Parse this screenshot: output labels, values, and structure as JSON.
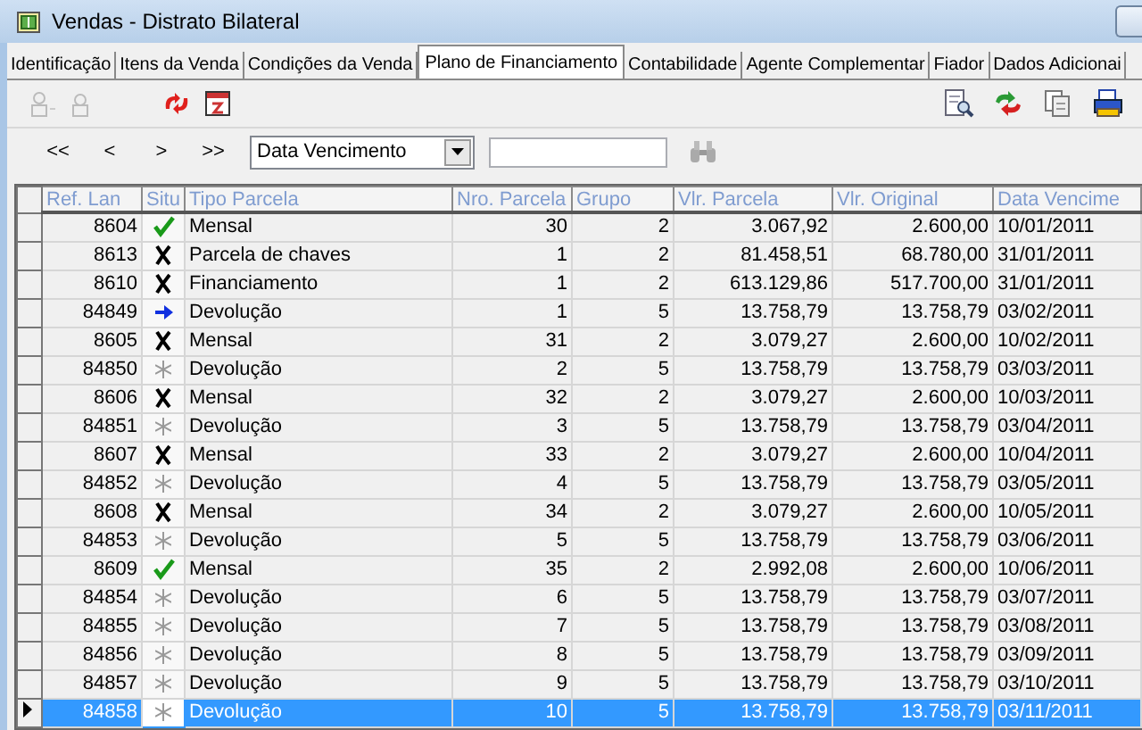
{
  "window": {
    "title": "Vendas - Distrato Bilateral"
  },
  "tabs": [
    {
      "label": "Identificação",
      "selected": false
    },
    {
      "label": "Itens da Venda",
      "selected": false
    },
    {
      "label": "Condições da Venda",
      "selected": false
    },
    {
      "label": "Plano de Financiamento",
      "selected": true
    },
    {
      "label": "Contabilidade",
      "selected": false
    },
    {
      "label": "Agente Complementar",
      "selected": false
    },
    {
      "label": "Fiador",
      "selected": false
    },
    {
      "label": "Dados Adicionai",
      "selected": false
    }
  ],
  "navigation": {
    "buttons": [
      "<<",
      "<",
      ">",
      ">>"
    ],
    "sort_field": {
      "value": "Data Vencimento"
    }
  },
  "table": {
    "columns": [
      "Ref. Lan",
      "Situ",
      "Tipo Parcela",
      "Nro. Parcela",
      "Grupo",
      "Vlr. Parcela",
      "Vlr. Original",
      "Data Vencime"
    ],
    "rows": [
      {
        "ref": "8604",
        "kind": "check",
        "tipo": "Mensal",
        "nro": "30",
        "grupo": "2",
        "vlr_parcela": "3.067,92",
        "vlr_original": "2.600,00",
        "data": "10/01/2011",
        "selected": false
      },
      {
        "ref": "8613",
        "kind": "cross",
        "tipo": "Parcela de chaves",
        "nro": "1",
        "grupo": "2",
        "vlr_parcela": "81.458,51",
        "vlr_original": "68.780,00",
        "data": "31/01/2011",
        "selected": false
      },
      {
        "ref": "8610",
        "kind": "cross",
        "tipo": "Financiamento",
        "nro": "1",
        "grupo": "2",
        "vlr_parcela": "613.129,86",
        "vlr_original": "517.700,00",
        "data": "31/01/2011",
        "selected": false
      },
      {
        "ref": "84849",
        "kind": "arrow",
        "tipo": "Devolução",
        "nro": "1",
        "grupo": "5",
        "vlr_parcela": "13.758,79",
        "vlr_original": "13.758,79",
        "data": "03/02/2011",
        "selected": false
      },
      {
        "ref": "8605",
        "kind": "cross",
        "tipo": "Mensal",
        "nro": "31",
        "grupo": "2",
        "vlr_parcela": "3.079,27",
        "vlr_original": "2.600,00",
        "data": "10/02/2011",
        "selected": false
      },
      {
        "ref": "84850",
        "kind": "asterisk",
        "tipo": "Devolução",
        "nro": "2",
        "grupo": "5",
        "vlr_parcela": "13.758,79",
        "vlr_original": "13.758,79",
        "data": "03/03/2011",
        "selected": false
      },
      {
        "ref": "8606",
        "kind": "cross",
        "tipo": "Mensal",
        "nro": "32",
        "grupo": "2",
        "vlr_parcela": "3.079,27",
        "vlr_original": "2.600,00",
        "data": "10/03/2011",
        "selected": false
      },
      {
        "ref": "84851",
        "kind": "asterisk",
        "tipo": "Devolução",
        "nro": "3",
        "grupo": "5",
        "vlr_parcela": "13.758,79",
        "vlr_original": "13.758,79",
        "data": "03/04/2011",
        "selected": false
      },
      {
        "ref": "8607",
        "kind": "cross",
        "tipo": "Mensal",
        "nro": "33",
        "grupo": "2",
        "vlr_parcela": "3.079,27",
        "vlr_original": "2.600,00",
        "data": "10/04/2011",
        "selected": false
      },
      {
        "ref": "84852",
        "kind": "asterisk",
        "tipo": "Devolução",
        "nro": "4",
        "grupo": "5",
        "vlr_parcela": "13.758,79",
        "vlr_original": "13.758,79",
        "data": "03/05/2011",
        "selected": false
      },
      {
        "ref": "8608",
        "kind": "cross",
        "tipo": "Mensal",
        "nro": "34",
        "grupo": "2",
        "vlr_parcela": "3.079,27",
        "vlr_original": "2.600,00",
        "data": "10/05/2011",
        "selected": false
      },
      {
        "ref": "84853",
        "kind": "asterisk",
        "tipo": "Devolução",
        "nro": "5",
        "grupo": "5",
        "vlr_parcela": "13.758,79",
        "vlr_original": "13.758,79",
        "data": "03/06/2011",
        "selected": false
      },
      {
        "ref": "8609",
        "kind": "check",
        "tipo": "Mensal",
        "nro": "35",
        "grupo": "2",
        "vlr_parcela": "2.992,08",
        "vlr_original": "2.600,00",
        "data": "10/06/2011",
        "selected": false
      },
      {
        "ref": "84854",
        "kind": "asterisk",
        "tipo": "Devolução",
        "nro": "6",
        "grupo": "5",
        "vlr_parcela": "13.758,79",
        "vlr_original": "13.758,79",
        "data": "03/07/2011",
        "selected": false
      },
      {
        "ref": "84855",
        "kind": "asterisk",
        "tipo": "Devolução",
        "nro": "7",
        "grupo": "5",
        "vlr_parcela": "13.758,79",
        "vlr_original": "13.758,79",
        "data": "03/08/2011",
        "selected": false
      },
      {
        "ref": "84856",
        "kind": "asterisk",
        "tipo": "Devolução",
        "nro": "8",
        "grupo": "5",
        "vlr_parcela": "13.758,79",
        "vlr_original": "13.758,79",
        "data": "03/09/2011",
        "selected": false
      },
      {
        "ref": "84857",
        "kind": "asterisk",
        "tipo": "Devolução",
        "nro": "9",
        "grupo": "5",
        "vlr_parcela": "13.758,79",
        "vlr_original": "13.758,79",
        "data": "03/10/2011",
        "selected": false
      },
      {
        "ref": "84858",
        "kind": "asterisk",
        "tipo": "Devolução",
        "nro": "10",
        "grupo": "5",
        "vlr_parcela": "13.758,79",
        "vlr_original": "13.758,79",
        "data": "03/11/2011",
        "selected": true
      }
    ]
  }
}
